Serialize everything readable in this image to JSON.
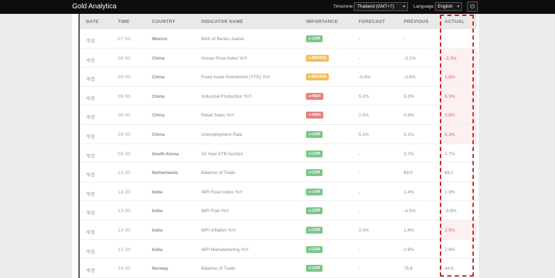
{
  "header": {
    "brand": "Gold Analytica",
    "timezone_label": "Timezone:",
    "timezone_value": "Thailand (GMT+7)",
    "language_label": "Language:",
    "language_value": "English"
  },
  "table": {
    "columns": [
      "DATE",
      "TIME",
      "COUNTRY",
      "INDICATOR NAME",
      "IMPORTANCE",
      "FORECAST",
      "PREVIOUS",
      "ACTUAL"
    ],
    "rows": [
      {
        "date": "今日",
        "time": "07:00",
        "country": "Mexico",
        "indicator": "Birth of Benito Juárez",
        "importance": "LOW",
        "forecast": "-",
        "previous": "-",
        "actual": "-",
        "neg": false
      },
      {
        "date": "今日",
        "time": "08:00",
        "country": "China",
        "indicator": "House Price Index YoY",
        "importance": "MEDIUM",
        "forecast": "-",
        "previous": "-3.1%",
        "actual": "-3.2%",
        "neg": true
      },
      {
        "date": "今日",
        "time": "09:00",
        "country": "China",
        "indicator": "Fixed Asset Investment (YTD) YoY",
        "importance": "MEDIUM",
        "forecast": "-0.4%",
        "previous": "-3.8%",
        "actual": "1.8%",
        "neg": true
      },
      {
        "date": "今日",
        "time": "09:00",
        "country": "China",
        "indicator": "Industrial Production YoY",
        "importance": "HIGH",
        "forecast": "5.1%",
        "previous": "5.2%",
        "actual": "6.3%",
        "neg": true
      },
      {
        "date": "今日",
        "time": "09:00",
        "country": "China",
        "indicator": "Retail Sales YoY",
        "importance": "HIGH",
        "forecast": "2.5%",
        "previous": "0.9%",
        "actual": "2.8%",
        "neg": true
      },
      {
        "date": "今日",
        "time": "09:00",
        "country": "China",
        "indicator": "Unemployment Rate",
        "importance": "LOW",
        "forecast": "5.1%",
        "previous": "5.1%",
        "actual": "5.3%",
        "neg": true
      },
      {
        "date": "今日",
        "time": "08:30",
        "country": "South Korea",
        "indicator": "10-Year KTB Auction",
        "importance": "LOW",
        "forecast": "-",
        "previous": "3.7%",
        "actual": "3.7%",
        "neg": false
      },
      {
        "date": "今日",
        "time": "12:30",
        "country": "Netherlands",
        "indicator": "Balance of Trade",
        "importance": "LOW",
        "forecast": "-",
        "previous": "€9.0",
        "actual": "€8.1",
        "neg": false
      },
      {
        "date": "今日",
        "time": "13:30",
        "country": "India",
        "indicator": "WPI Food Index YoY",
        "importance": "LOW",
        "forecast": "-",
        "previous": "1.4%",
        "actual": "1.9%",
        "neg": false
      },
      {
        "date": "今日",
        "time": "13:30",
        "country": "India",
        "indicator": "WPI Fuel YoY",
        "importance": "LOW",
        "forecast": "-",
        "previous": "-4.0%",
        "actual": "-3.8%",
        "neg": false
      },
      {
        "date": "今日",
        "time": "13:30",
        "country": "India",
        "indicator": "WPI Inflation YoY",
        "importance": "LOW",
        "forecast": "2.0%",
        "previous": "1.8%",
        "actual": "2.5%",
        "neg": true
      },
      {
        "date": "今日",
        "time": "13:30",
        "country": "India",
        "indicator": "WPI Manufacturing YoY",
        "importance": "LOW",
        "forecast": "-",
        "previous": "2.9%",
        "actual": "2.9%",
        "neg": false
      },
      {
        "date": "今日",
        "time": "14:00",
        "country": "Norway",
        "indicator": "Balance of Trade",
        "importance": "LOW",
        "forecast": "-",
        "previous": "75.8",
        "actual": "44.6",
        "neg": false
      }
    ]
  }
}
